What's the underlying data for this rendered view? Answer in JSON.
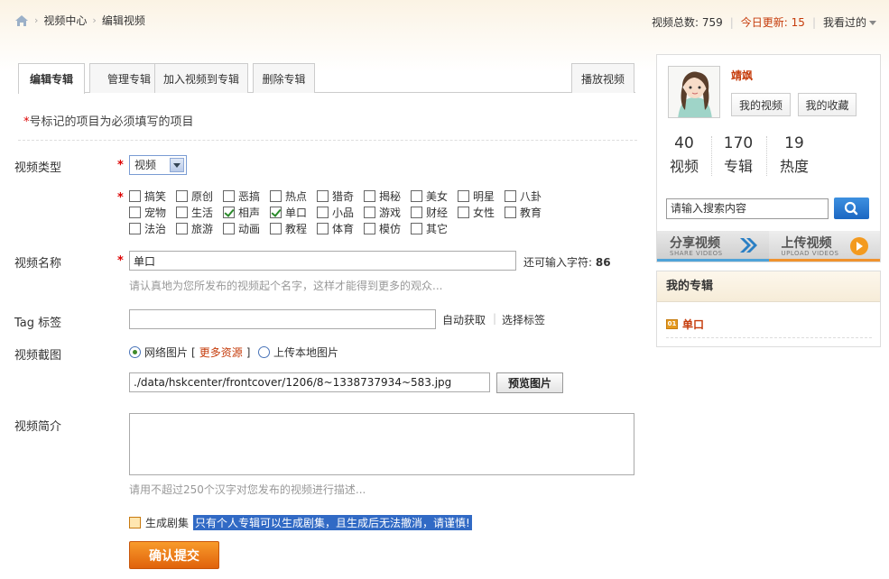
{
  "breadcrumb": {
    "sep": "›",
    "items": [
      "视频中心",
      "编辑视频"
    ]
  },
  "stats": {
    "total_label": "视频总数: 759",
    "today_label": "今日更新: 15",
    "watched_label": "我看过的"
  },
  "tabs": [
    "编辑专辑",
    "管理专辑",
    "加入视频到专辑",
    "删除专辑"
  ],
  "play_tab": "播放视频",
  "form": {
    "star": "*",
    "note_text": "号标记的项目为必须填写的项目",
    "type_label": "视频类型",
    "type_value": "视频",
    "categories": [
      {
        "label": "搞笑",
        "checked": false
      },
      {
        "label": "原创",
        "checked": false
      },
      {
        "label": "恶搞",
        "checked": false
      },
      {
        "label": "热点",
        "checked": false
      },
      {
        "label": "猎奇",
        "checked": false
      },
      {
        "label": "揭秘",
        "checked": false
      },
      {
        "label": "美女",
        "checked": false
      },
      {
        "label": "明星",
        "checked": false
      },
      {
        "label": "八卦",
        "checked": false
      },
      {
        "label": "宠物",
        "checked": false
      },
      {
        "label": "生活",
        "checked": false
      },
      {
        "label": "相声",
        "checked": true
      },
      {
        "label": "单口",
        "checked": true
      },
      {
        "label": "小品",
        "checked": false
      },
      {
        "label": "游戏",
        "checked": false
      },
      {
        "label": "财经",
        "checked": false
      },
      {
        "label": "女性",
        "checked": false
      },
      {
        "label": "教育",
        "checked": false
      },
      {
        "label": "法治",
        "checked": false
      },
      {
        "label": "旅游",
        "checked": false
      },
      {
        "label": "动画",
        "checked": false
      },
      {
        "label": "教程",
        "checked": false
      },
      {
        "label": "体育",
        "checked": false
      },
      {
        "label": "模仿",
        "checked": false
      },
      {
        "label": "其它",
        "checked": false
      }
    ],
    "name_label": "视频名称",
    "name_value": "单口",
    "remaining_label": "还可输入字符:",
    "remaining_count": "86",
    "name_hint": "请认真地为您所发布的视频起个名字，这样才能得到更多的观众...",
    "tag_label": "Tag 标签",
    "tag_value": "",
    "auto_get": "自动获取",
    "choose_tag": "选择标签",
    "cover_label": "视频截图",
    "radio_web": "网络图片",
    "bracket_open": "[",
    "more_resources": "更多资源",
    "bracket_close": "]",
    "radio_local": "上传本地图片",
    "cover_path": "./data/hskcenter/frontcover/1206/8~1338737934~583.jpg",
    "preview_btn": "预览图片",
    "intro_label": "视频简介",
    "intro_value": "",
    "intro_hint": "请用不超过250个汉字对您发布的视频进行描述...",
    "gen_label": "生成剧集",
    "gen_note": "只有个人专辑可以生成剧集，且生成后无法撤消，请谨慎!",
    "submit": "确认提交"
  },
  "profile": {
    "username": "靖飒",
    "my_videos": "我的视频",
    "my_favorites": "我的收藏",
    "stats": [
      {
        "value": "40",
        "label": "视频"
      },
      {
        "value": "170",
        "label": "专辑"
      },
      {
        "value": "19",
        "label": "热度"
      }
    ],
    "search_placeholder": "请输入搜索内容",
    "share_big": "分享视频",
    "share_small": "SHARE VIDEOS",
    "upload_big": "上传视频",
    "upload_small": "UPLOAD VIDEOS"
  },
  "album": {
    "title": "我的专辑",
    "badge": "01",
    "item": "单口"
  }
}
